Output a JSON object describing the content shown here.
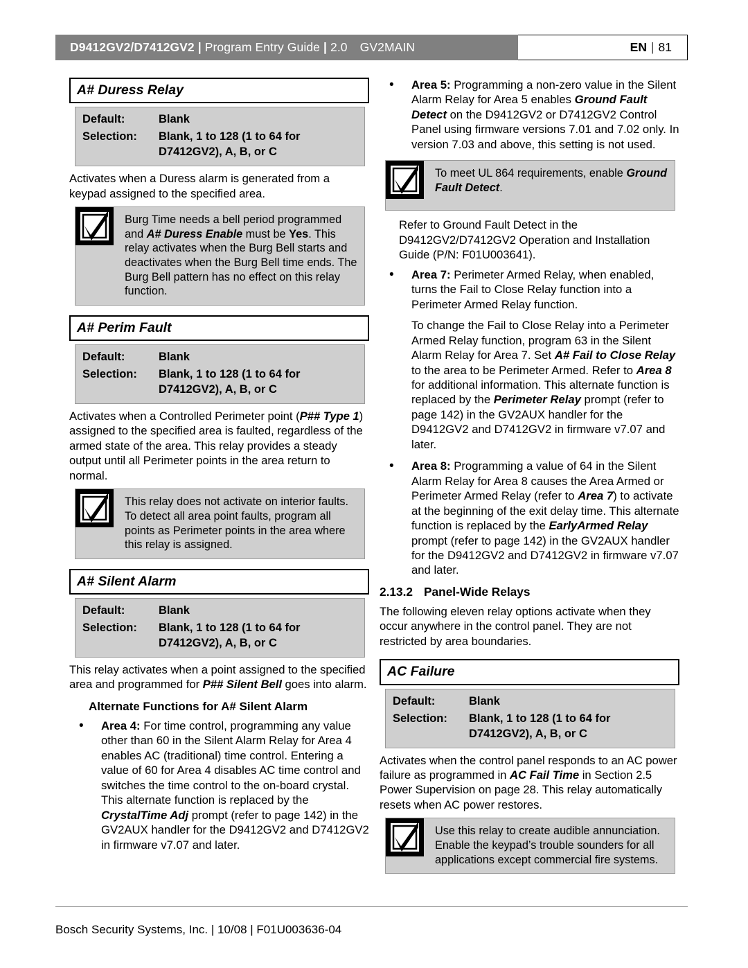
{
  "header": {
    "product": "D9412GV2/D7412GV2",
    "sep": "|",
    "guide": "Program Entry Guide",
    "version": "2.0",
    "handler": "GV2MAIN",
    "lang": "EN",
    "page_number": "81"
  },
  "spec_labels": {
    "default": "Default:",
    "selection": "Selection:"
  },
  "common": {
    "default_value": "Blank",
    "selection_line1": "Blank, 1 to 128 (1 to 64 for",
    "selection_line2": "D7412GV2), A, B, or C"
  },
  "left_column": {
    "duress_relay": {
      "title": "A# Duress Relay",
      "body": "Activates when a Duress alarm is generated from a keypad assigned to the specified area.",
      "notice": {
        "part1": "Burg Time needs a bell period programmed and ",
        "emphasis1": "A# Duress Enable",
        "part2": " must be ",
        "emphasis2": "Yes",
        "part3": ". This relay activates when the Burg Bell starts and deactivates when the Burg Bell time ends. The Burg Bell pattern has no effect on this relay function."
      }
    },
    "perim_fault": {
      "title": "A# Perim Fault",
      "body_part1": "Activates when a Controlled Perimeter point (",
      "body_emphasis": "P## Type 1",
      "body_part2": ") assigned to the specified area is faulted, regardless of the armed state of the area. This relay provides a steady output until all Perimeter points in the area return to normal.",
      "notice": "This relay does not activate on interior faults. To detect all area point faults, program all points as Perimeter points in the area where this relay is assigned."
    },
    "silent_alarm": {
      "title": "A# Silent Alarm",
      "body_part1": "This relay activates when a point assigned to the specified area and programmed for ",
      "body_emphasis": "P## Silent Bell",
      "body_part2": " goes into alarm.",
      "alt_heading": "Alternate Functions for A# Silent Alarm",
      "bullet_area4": {
        "label": "Area 4:",
        "part1": " For time control, programming any value other than 60 in the Silent Alarm Relay for Area 4 enables AC (traditional) time control. Entering a value of 60 for Area 4 disables AC time control and switches the time control to the on-board crystal. This alternate function is replaced by the ",
        "emphasis": "CrystalTime Adj",
        "part2": " prompt (refer to page 142) in the GV2AUX handler for the D9412GV2 and D7412GV2 in firmware v7.07 and later."
      }
    }
  },
  "right_column": {
    "bullet_area5": {
      "label": "Area 5:",
      "part1": " Programming a non-zero value in the Silent Alarm Relay for Area 5 enables ",
      "emphasis": "Ground Fault Detect",
      "part2": " on the D9412GV2 or D7412GV2 Control Panel using firmware versions 7.01 and 7.02 only. In version 7.03 and above, this setting is not used."
    },
    "notice_ul864": {
      "part1": "To meet UL 864 requirements, enable ",
      "emphasis": "Ground Fault Detect",
      "part2": "."
    },
    "refer_ground_fault": "Refer to Ground Fault Detect in the D9412GV2/D7412GV2 Operation and Installation Guide (P/N: F01U003641).",
    "bullet_area7": {
      "label": "Area 7:",
      "part1": " Perimeter Armed Relay, when enabled, turns the Fail to Close Relay function into a Perimeter Armed Relay function.",
      "p2_part1": "To change the Fail to Close Relay into a Perimeter Armed Relay function, program 63 in the Silent Alarm Relay for Area 7. Set ",
      "p2_emphasis1": "A# Fail to Close Relay",
      "p2_part2": " to the area to be Perimeter Armed. Refer to ",
      "p2_emphasis2": "Area 8",
      "p2_part3": " for additional information. This alternate function is replaced by the ",
      "p2_emphasis3": "Perimeter Relay",
      "p2_part4": " prompt (refer to page 142) in the GV2AUX handler for the D9412GV2 and D7412GV2 in firmware v7.07 and later."
    },
    "bullet_area8": {
      "label": "Area 8:",
      "part1": " Programming a value of 64 in the Silent Alarm Relay for Area 8 causes the Area Armed or Perimeter Armed Relay (refer to ",
      "emphasis1": "Area 7",
      "part2": ") to activate at the beginning of the exit delay time. This alternate function is replaced by the ",
      "emphasis2": "EarlyArmed Relay",
      "part3": " prompt (refer to page 142) in the GV2AUX handler for the D9412GV2 and D7412GV2 in firmware v7.07 and later."
    },
    "section": {
      "number": "2.13.2",
      "title": "Panel-Wide Relays",
      "body": "The following eleven relay options activate when they occur anywhere in the control panel. They are not restricted by area boundaries."
    },
    "ac_failure": {
      "title": "AC Failure",
      "body_part1": "Activates when the control panel responds to an AC power failure as programmed in ",
      "body_emphasis": "AC Fail Time",
      "body_part2": " in Section 2.5 Power Supervision on page 28. This relay automatically resets when AC power restores.",
      "notice": "Use this relay to create audible annunciation. Enable the keypad’s trouble sounders for all applications except commercial fire systems."
    }
  },
  "footer": {
    "text": "Bosch Security Systems, Inc. | 10/08 | F01U003636-04"
  },
  "icons": {
    "notice_check": "check-box-icon"
  },
  "colors": {
    "header_bar": "#808080",
    "spec_box": "#cfcfcf",
    "notice_bg": "#cfcfcf",
    "icon_bg": "#000000"
  }
}
